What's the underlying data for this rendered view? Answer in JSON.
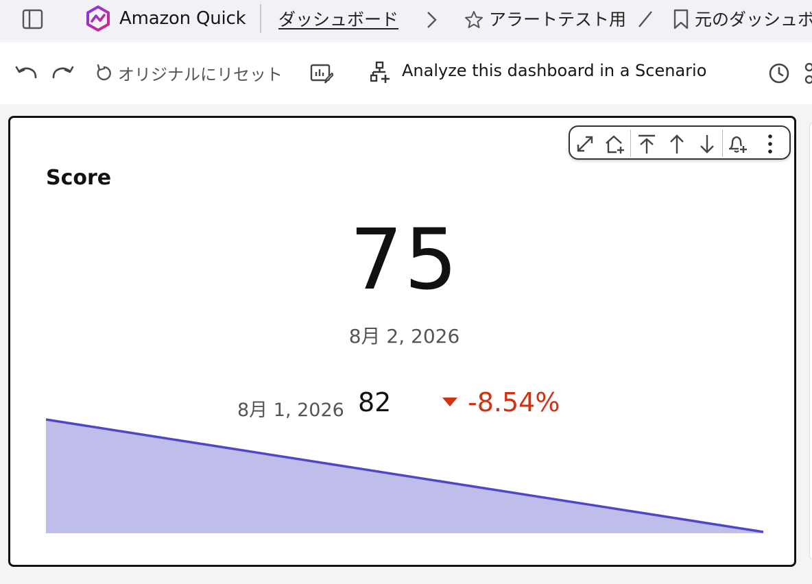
{
  "topbar": {
    "app_name": "Amazon Quick",
    "breadcrumb_dashboards": "ダッシュボード",
    "breadcrumb_current": "アラートテスト用",
    "breadcrumb_original": "元のダッシュボ",
    "brand_color": "#c026d3"
  },
  "toolbar": {
    "reset_label": "オリジナルにリセット",
    "scenario_label": "Analyze this dashboard in a Scenario"
  },
  "visual": {
    "title": "Score",
    "kpi_value": "75",
    "kpi_date": "8月 2, 2026",
    "comparison_date": "8月 1, 2026",
    "comparison_value": "82",
    "delta": "-8.54%",
    "delta_color": "#d13212",
    "series_color": "#4f46c8",
    "fill_color": "#bfbde9",
    "menu_icons": [
      "expand-icon",
      "add-to-home-icon",
      "move-to-top-icon",
      "move-up-icon",
      "move-down-icon",
      "add-alert-icon",
      "more-options-icon"
    ]
  },
  "chart_data": {
    "type": "area",
    "x": [
      "8月 1, 2026",
      "8月 2, 2026"
    ],
    "values": [
      82,
      75
    ],
    "title": "Score",
    "xlabel": "",
    "ylabel": "",
    "grid": false
  }
}
